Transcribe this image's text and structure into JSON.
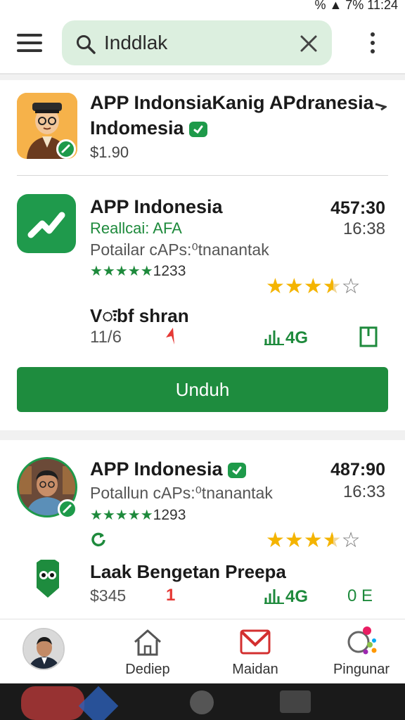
{
  "status_bar": {
    "right_text": "%  ▲ 7% 11:24"
  },
  "search": {
    "value": "Inddlak"
  },
  "colors": {
    "accent_green": "#1e8c3e",
    "rating_star": "#f4b400",
    "alert_red": "#e53935"
  },
  "featured": {
    "title_line1": "APP IndonsiaKanig APdranesia",
    "title_line2": "Indomesia",
    "price": "$1.90",
    "side_icon": "chevron-icon"
  },
  "app1": {
    "title": "APP Indonesia",
    "subtitle": "Reallcai: AFA",
    "description": "Potailar cAPs:⁰tnanantak",
    "stars_small": "★★★★★",
    "rating_count": "1233",
    "value_top": "457:30",
    "value_time": "16:38",
    "rating": 4.5,
    "feature_title": "Vःbf shran",
    "feature_count": "11/6",
    "action_label": "4G",
    "download_label": "Unduh"
  },
  "app2": {
    "title": "APP Indonesia",
    "description": "Potallun cAPs:⁰tnanantak",
    "stars_small": "★★★★★",
    "rating_count": "1293",
    "value_top": "487:90",
    "value_time": "16:33",
    "rating": 4.5,
    "sub_title": "Laak Bengetan Preepa",
    "sub_price": "$345",
    "sub_number": "1",
    "action_label": "4G",
    "action_right": "0 E"
  },
  "bottom_nav": [
    {
      "label": ""
    },
    {
      "label": "Dediep"
    },
    {
      "label": "Maidan"
    },
    {
      "label": "Pingunar"
    }
  ]
}
